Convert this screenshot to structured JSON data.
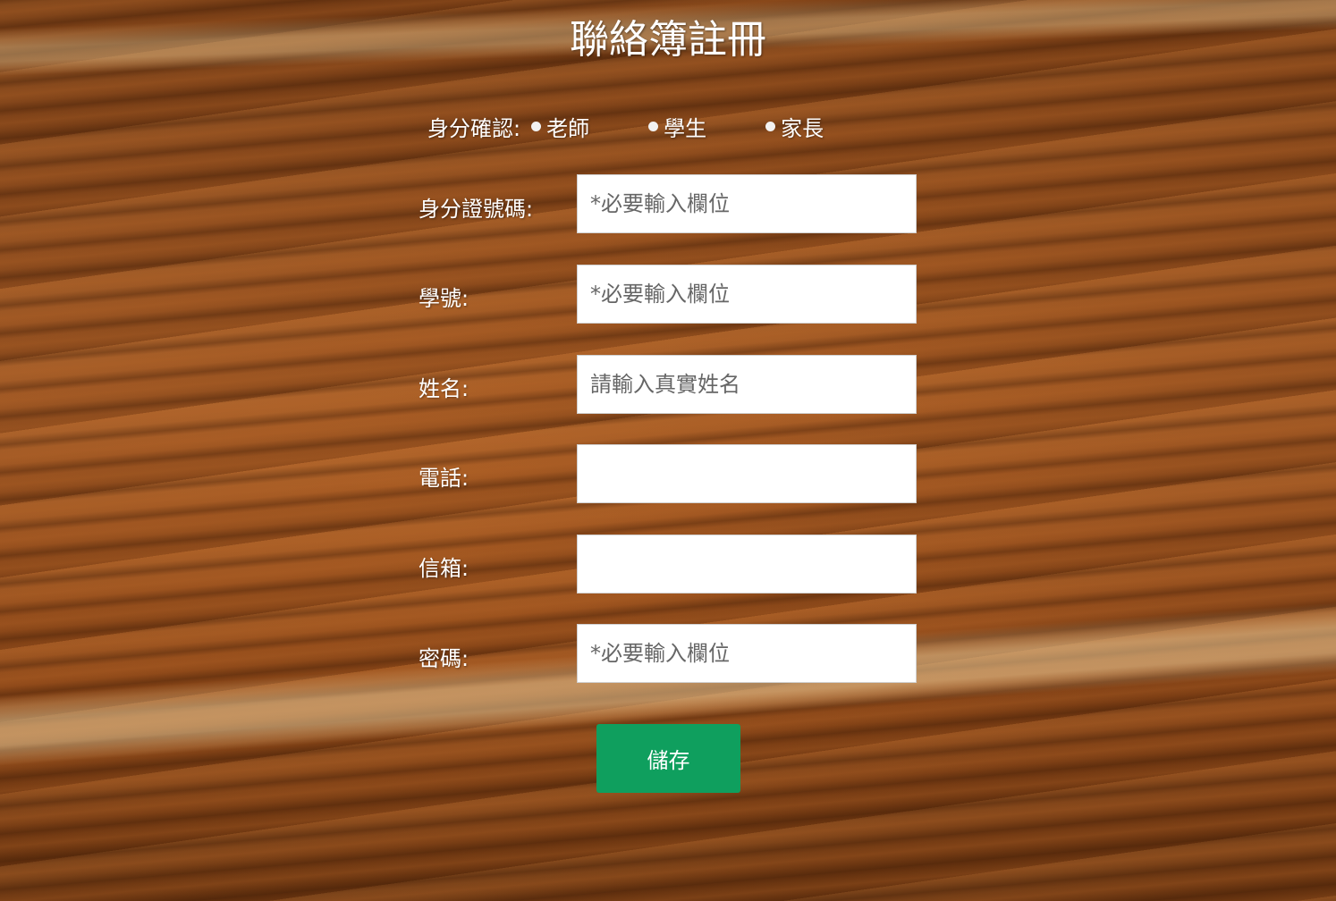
{
  "page": {
    "title": "聯絡簿註冊"
  },
  "identity": {
    "label": "身分確認:",
    "options": [
      {
        "label": "老師"
      },
      {
        "label": "學生"
      },
      {
        "label": "家長"
      }
    ]
  },
  "fields": [
    {
      "label": "身分證號碼:",
      "placeholder": "*必要輸入欄位",
      "value": ""
    },
    {
      "label": "學號:",
      "placeholder": "*必要輸入欄位",
      "value": ""
    },
    {
      "label": "姓名:",
      "placeholder": "請輸入真實姓名",
      "value": ""
    },
    {
      "label": "電話:",
      "placeholder": "",
      "value": ""
    },
    {
      "label": "信箱:",
      "placeholder": "",
      "value": ""
    },
    {
      "label": "密碼:",
      "placeholder": "*必要輸入欄位",
      "value": ""
    }
  ],
  "actions": {
    "save_label": "儲存"
  },
  "colors": {
    "button_green": "#0f9f5e",
    "text": "#ffffff",
    "input_bg": "#ffffff"
  }
}
